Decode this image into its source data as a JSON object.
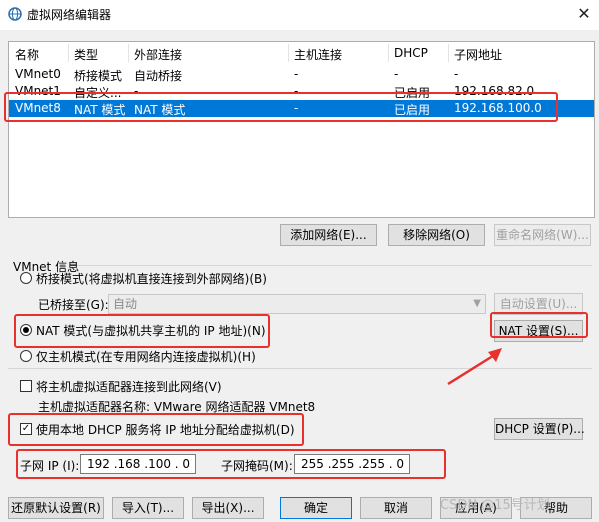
{
  "window": {
    "title": "虚拟网络编辑器",
    "close": "✕"
  },
  "table": {
    "headers": [
      "名称",
      "类型",
      "外部连接",
      "主机连接",
      "DHCP",
      "子网地址"
    ],
    "rows": [
      [
        "VMnet0",
        "桥接模式",
        "自动桥接",
        "-",
        "-",
        "-"
      ],
      [
        "VMnet1",
        "自定义...",
        "-",
        "-",
        "已启用",
        "192.168.82.0"
      ],
      [
        "VMnet8",
        "NAT 模式",
        "NAT 模式",
        "-",
        "已启用",
        "192.168.100.0"
      ]
    ],
    "selected_row": 2
  },
  "list_buttons": {
    "add": "添加网络(E)...",
    "remove": "移除网络(O)",
    "rename": "重命名网络(W)..."
  },
  "vmnet_info": {
    "title": "VMnet 信息",
    "bridged_label": "桥接模式(将虚拟机直接连接到外部网络)(B)",
    "bridged_to_label": "已桥接至(G):",
    "bridged_to_value": "自动",
    "auto_settings": "自动设置(U)...",
    "nat_label": "NAT 模式(与虚拟机共享主机的 IP 地址)(N)",
    "nat_settings": "NAT 设置(S)...",
    "hostonly_label": "仅主机模式(在专用网络内连接虚拟机)(H)",
    "connect_adapter_label": "将主机虚拟适配器连接到此网络(V)",
    "adapter_name_text": "主机虚拟适配器名称: VMware 网络适配器 VMnet8",
    "dhcp_label": "使用本地 DHCP 服务将 IP 地址分配给虚拟机(D)",
    "dhcp_settings": "DHCP 设置(P)...",
    "subnet_ip_label": "子网 IP (I):",
    "subnet_ip_value": "192 .168 .100 . 0",
    "subnet_mask_label": "子网掩码(M):",
    "subnet_mask_value": "255 .255 .255 . 0"
  },
  "footer_buttons": {
    "restore": "还原默认设置(R)",
    "import": "导入(T)...",
    "export": "导出(X)...",
    "ok": "确定",
    "cancel": "取消",
    "apply": "应用(A)",
    "help": "帮助"
  },
  "watermark": "CSDN @15号计划",
  "colors": {
    "selection": "#0078d7",
    "highlight_annotation": "#e8312f",
    "arrow": "#e8312f"
  }
}
